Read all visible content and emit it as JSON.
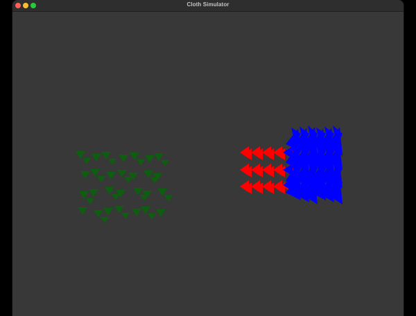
{
  "window": {
    "title": "Cloth Simulator"
  },
  "controls": [
    {
      "name": "close",
      "color": "#ff5f57"
    },
    {
      "name": "minimize",
      "color": "#febc2e"
    },
    {
      "name": "maximize",
      "color": "#28c840"
    }
  ],
  "scene": {
    "background": "#383838",
    "cloths": [
      {
        "name": "green-cloth",
        "color": "#0e5d10",
        "rows": 4,
        "cols": 5
      },
      {
        "name": "red-cloth",
        "color": "#ff0000",
        "rows": 3,
        "cols": 5
      },
      {
        "name": "blue-cloth",
        "color": "#0000ff",
        "rows": 3,
        "cols": 5
      }
    ]
  }
}
